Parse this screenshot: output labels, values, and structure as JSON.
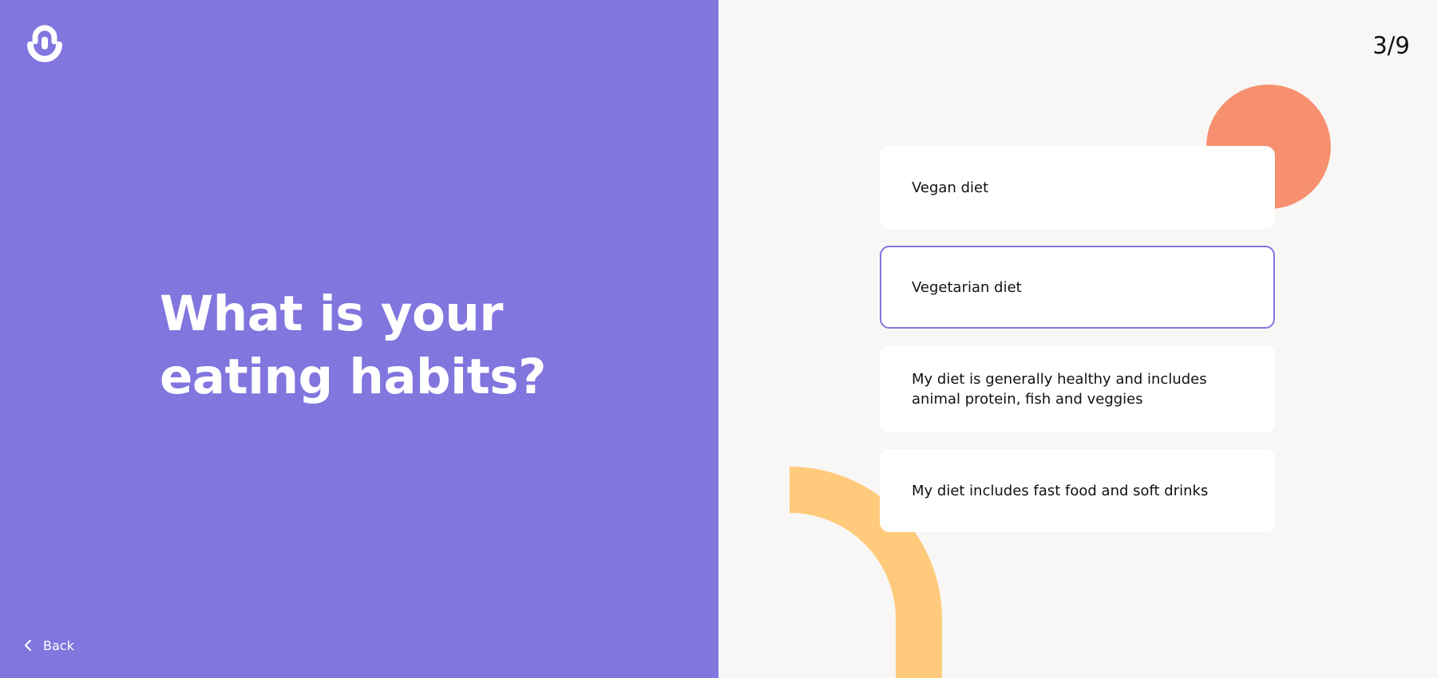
{
  "left": {
    "question": "What is your eating habits?",
    "back_label": "Back"
  },
  "right": {
    "step": "3/9",
    "options": [
      {
        "label": "Vegan diet"
      },
      {
        "label": "Vegetarian diet",
        "selected": true
      },
      {
        "label": "My diet is generally healthy and includes animal protein, fish and veggies"
      },
      {
        "label": "My diet includes fast food and soft drinks"
      }
    ]
  },
  "colors": {
    "accent": "#8175de",
    "background": "#f8f7f6",
    "coral": "#f7906e",
    "yellow": "#ffca7b"
  },
  "icons": {
    "logo": "lock-logo-icon",
    "back": "chevron-left-icon"
  }
}
